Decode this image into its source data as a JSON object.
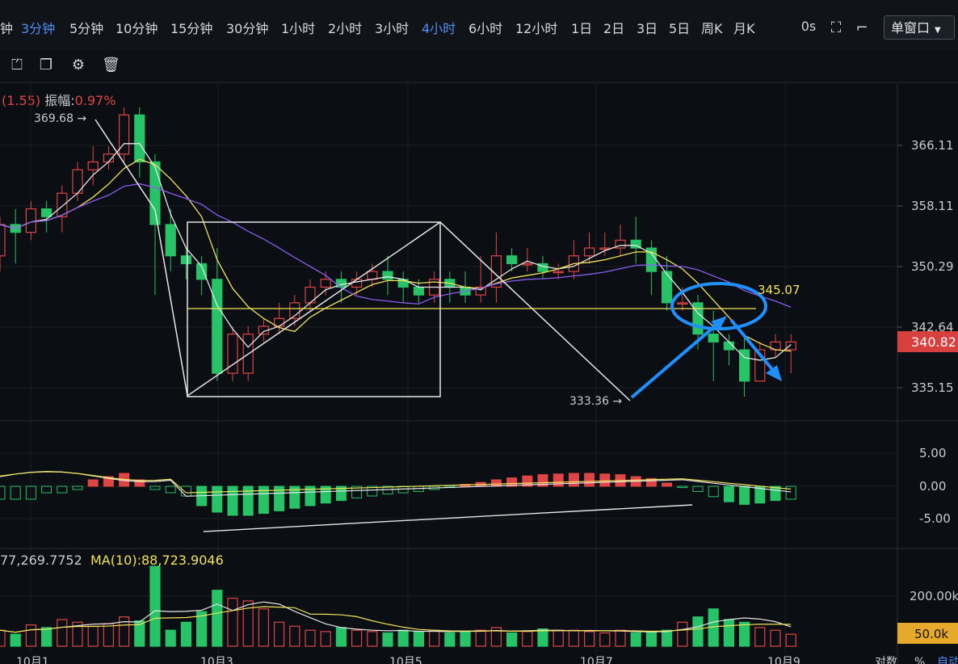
{
  "toolbar": {
    "timeframes": [
      "钟",
      "3分钟",
      "5分钟",
      "10分钟",
      "15分钟",
      "30分钟",
      "1小时",
      "2小时",
      "3小时",
      "4小时",
      "6小时",
      "12小时",
      "1日",
      "2日",
      "3日",
      "5日",
      "周K",
      "月K"
    ],
    "active": [
      "3分钟",
      "4小时"
    ],
    "countdown": "0s",
    "window_mode": "单窗口"
  },
  "info": {
    "change": "(1.55)",
    "amp_label": "振幅:",
    "amp_value": "0.97%"
  },
  "volume_info": {
    "value": "77,269.7752",
    "ma10": "MA(10):88,723.9046"
  },
  "colors": {
    "up": "#e04545",
    "down": "#26c367",
    "ma_white": "#e6e6e6",
    "ma_yellow": "#f2e35a",
    "ma_purple": "#8a5cf0",
    "arrow_blue": "#1e90ff"
  },
  "chart_data": {
    "type": "candlestick",
    "main": {
      "y_ticks": [
        "366.11",
        "358.11",
        "350.29",
        "342.64",
        "335.15"
      ],
      "high_label": "369.68",
      "low_label": "333.36",
      "current_price": "340.82",
      "level_label": "345.07",
      "level": 345.07,
      "candles": [
        [
          352,
          356,
          350,
          357
        ],
        [
          356,
          355,
          351,
          358
        ],
        [
          355,
          358,
          354,
          359
        ],
        [
          358,
          357,
          355,
          359
        ],
        [
          357,
          360,
          355,
          361
        ],
        [
          360,
          363,
          359,
          364
        ],
        [
          363,
          364,
          361,
          366
        ],
        [
          364,
          365,
          363,
          366
        ],
        [
          365,
          370,
          364,
          371
        ],
        [
          370,
          364,
          362,
          371
        ],
        [
          364,
          356,
          347,
          365
        ],
        [
          356,
          352,
          350,
          358
        ],
        [
          352,
          351,
          349,
          353
        ],
        [
          351,
          349,
          347,
          352
        ],
        [
          349,
          337,
          336,
          353
        ],
        [
          337,
          342,
          336,
          343
        ],
        [
          337,
          342,
          336,
          343
        ],
        [
          342,
          343,
          341,
          344
        ],
        [
          343,
          344,
          342,
          346
        ],
        [
          344,
          346,
          343,
          347
        ],
        [
          346,
          348,
          345,
          349
        ],
        [
          348,
          349,
          347,
          350
        ],
        [
          349,
          348,
          346,
          350
        ],
        [
          348,
          349,
          347,
          350
        ],
        [
          349,
          350,
          348,
          351
        ],
        [
          350,
          349,
          347,
          352
        ],
        [
          349,
          348,
          346,
          350
        ],
        [
          348,
          347,
          346,
          349
        ],
        [
          347,
          349,
          346,
          350
        ],
        [
          349,
          348,
          346,
          350
        ],
        [
          348,
          347,
          346,
          350
        ],
        [
          347,
          348,
          346,
          352
        ],
        [
          348,
          352,
          346,
          355
        ],
        [
          352,
          351,
          350,
          353
        ],
        [
          351,
          351,
          350,
          353
        ],
        [
          351,
          350,
          349,
          352
        ],
        [
          350,
          350,
          349,
          351
        ],
        [
          350,
          352,
          349,
          354
        ],
        [
          352,
          353,
          351,
          355
        ],
        [
          353,
          353,
          352,
          355
        ],
        [
          353,
          354,
          352,
          356
        ],
        [
          354,
          353,
          351,
          357
        ],
        [
          353,
          350,
          347,
          354
        ],
        [
          350,
          346,
          345,
          352
        ],
        [
          346,
          346,
          345,
          348
        ],
        [
          346,
          342,
          340,
          347
        ],
        [
          342,
          341,
          336,
          345
        ],
        [
          341,
          340,
          338,
          342
        ],
        [
          340,
          336,
          334,
          342
        ],
        [
          336,
          340,
          336,
          341
        ],
        [
          340,
          341,
          339,
          342
        ],
        [
          340,
          341,
          337,
          342
        ]
      ],
      "date_ticks": [
        "10月1",
        "10月3",
        "10月5",
        "10月7",
        "10月9"
      ]
    },
    "macd": {
      "y_ticks": [
        "5.00",
        "0.00",
        "-5.00"
      ]
    },
    "volume": {
      "y_ticks": [
        "200.00k"
      ],
      "current": "50.0k"
    },
    "footer": [
      "对数",
      "%",
      "自动"
    ]
  }
}
